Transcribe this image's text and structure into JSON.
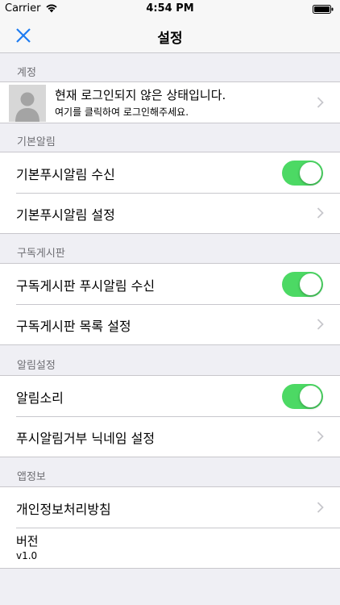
{
  "status_bar": {
    "carrier": "Carrier",
    "time": "4:54 PM"
  },
  "nav": {
    "title": "설정"
  },
  "sections": {
    "account": {
      "header": "계정",
      "main_text": "현재 로그인되지 않은 상태입니다.",
      "sub_text": "여기를 클릭하여 로그인해주세요."
    },
    "basic": {
      "header": "기본알림",
      "push_label": "기본푸시알림 수신",
      "push_on": true,
      "settings_label": "기본푸시알림 설정"
    },
    "subscribed": {
      "header": "구독게시판",
      "push_label": "구독게시판 푸시알림 수신",
      "push_on": true,
      "list_label": "구독게시판 목록 설정"
    },
    "alerts": {
      "header": "알림설정",
      "sound_label": "알림소리",
      "sound_on": true,
      "nickname_label": "푸시알림거부 닉네임 설정"
    },
    "app_info": {
      "header": "앱정보",
      "privacy_label": "개인정보처리방침",
      "version_label": "버전",
      "version_value": "v1.0"
    }
  },
  "colors": {
    "toggle_on": "#4cd964",
    "accent": "#1e7cf2",
    "background": "#efeff4"
  }
}
